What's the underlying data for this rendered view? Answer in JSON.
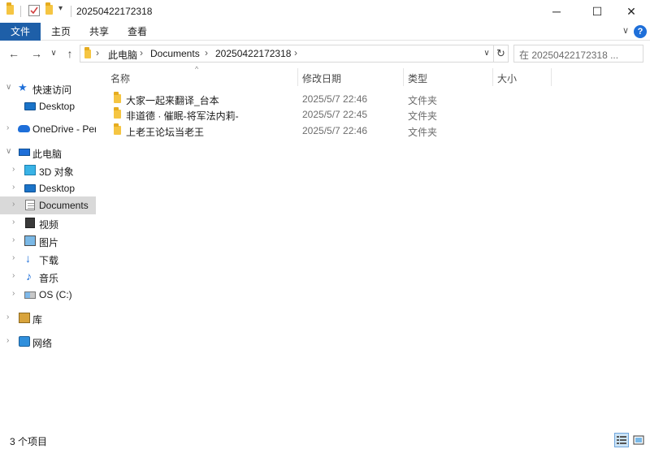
{
  "window": {
    "title": "20250422172318",
    "minimize_glyph": "─",
    "maximize_glyph": "☐",
    "close_glyph": "✕"
  },
  "quick_access_toolbar": {
    "dropdown_glyph": "▾"
  },
  "ribbon": {
    "tabs": [
      "文件",
      "主页",
      "共享",
      "查看"
    ],
    "collapse_glyph": "∨",
    "help_glyph": "?"
  },
  "nav": {
    "back_glyph": "←",
    "forward_glyph": "→",
    "recent_glyph": "∨",
    "up_glyph": "↑",
    "address_segments": [
      "此电脑",
      "Documents",
      "20250422172318"
    ],
    "address_sep": "›",
    "address_drop_glyph": "∨",
    "refresh_glyph": "↻",
    "search_placeholder": "在 20250422172318 ..."
  },
  "sidebar": {
    "items": [
      {
        "label": "快速访问",
        "icon": "star-icon"
      },
      {
        "label": "Desktop",
        "icon": "desktop-icon"
      },
      {
        "label": "OneDrive - Per",
        "icon": "cloud-icon"
      },
      {
        "label": "此电脑",
        "icon": "computer-icon"
      },
      {
        "label": "3D 对象",
        "icon": "cube-icon"
      },
      {
        "label": "Desktop",
        "icon": "desktop-icon"
      },
      {
        "label": "Documents",
        "icon": "document-icon"
      },
      {
        "label": "视频",
        "icon": "video-icon"
      },
      {
        "label": "图片",
        "icon": "picture-icon"
      },
      {
        "label": "下载",
        "icon": "download-icon"
      },
      {
        "label": "音乐",
        "icon": "music-icon"
      },
      {
        "label": "OS (C:)",
        "icon": "drive-icon"
      },
      {
        "label": "库",
        "icon": "library-icon"
      },
      {
        "label": "网络",
        "icon": "network-icon"
      }
    ],
    "expand_glyph": "›",
    "expanded_glyph": "∨"
  },
  "columns": {
    "name": "名称",
    "date": "修改日期",
    "type": "类型",
    "size": "大小",
    "sort_glyph": "^"
  },
  "files": [
    {
      "name": "大家一起来翻译_台本",
      "date": "2025/5/7 22:46",
      "type": "文件夹",
      "size": ""
    },
    {
      "name": "非道德 · 催眠-将军法内莉-",
      "date": "2025/5/7 22:45",
      "type": "文件夹",
      "size": ""
    },
    {
      "name": "上老王论坛当老王",
      "date": "2025/5/7 22:46",
      "type": "文件夹",
      "size": ""
    }
  ],
  "status": {
    "item_count": "3 个项目"
  },
  "colors": {
    "accent": "#1e5fa8",
    "folder": "#f5c542",
    "selection": "#d9d9d9"
  }
}
